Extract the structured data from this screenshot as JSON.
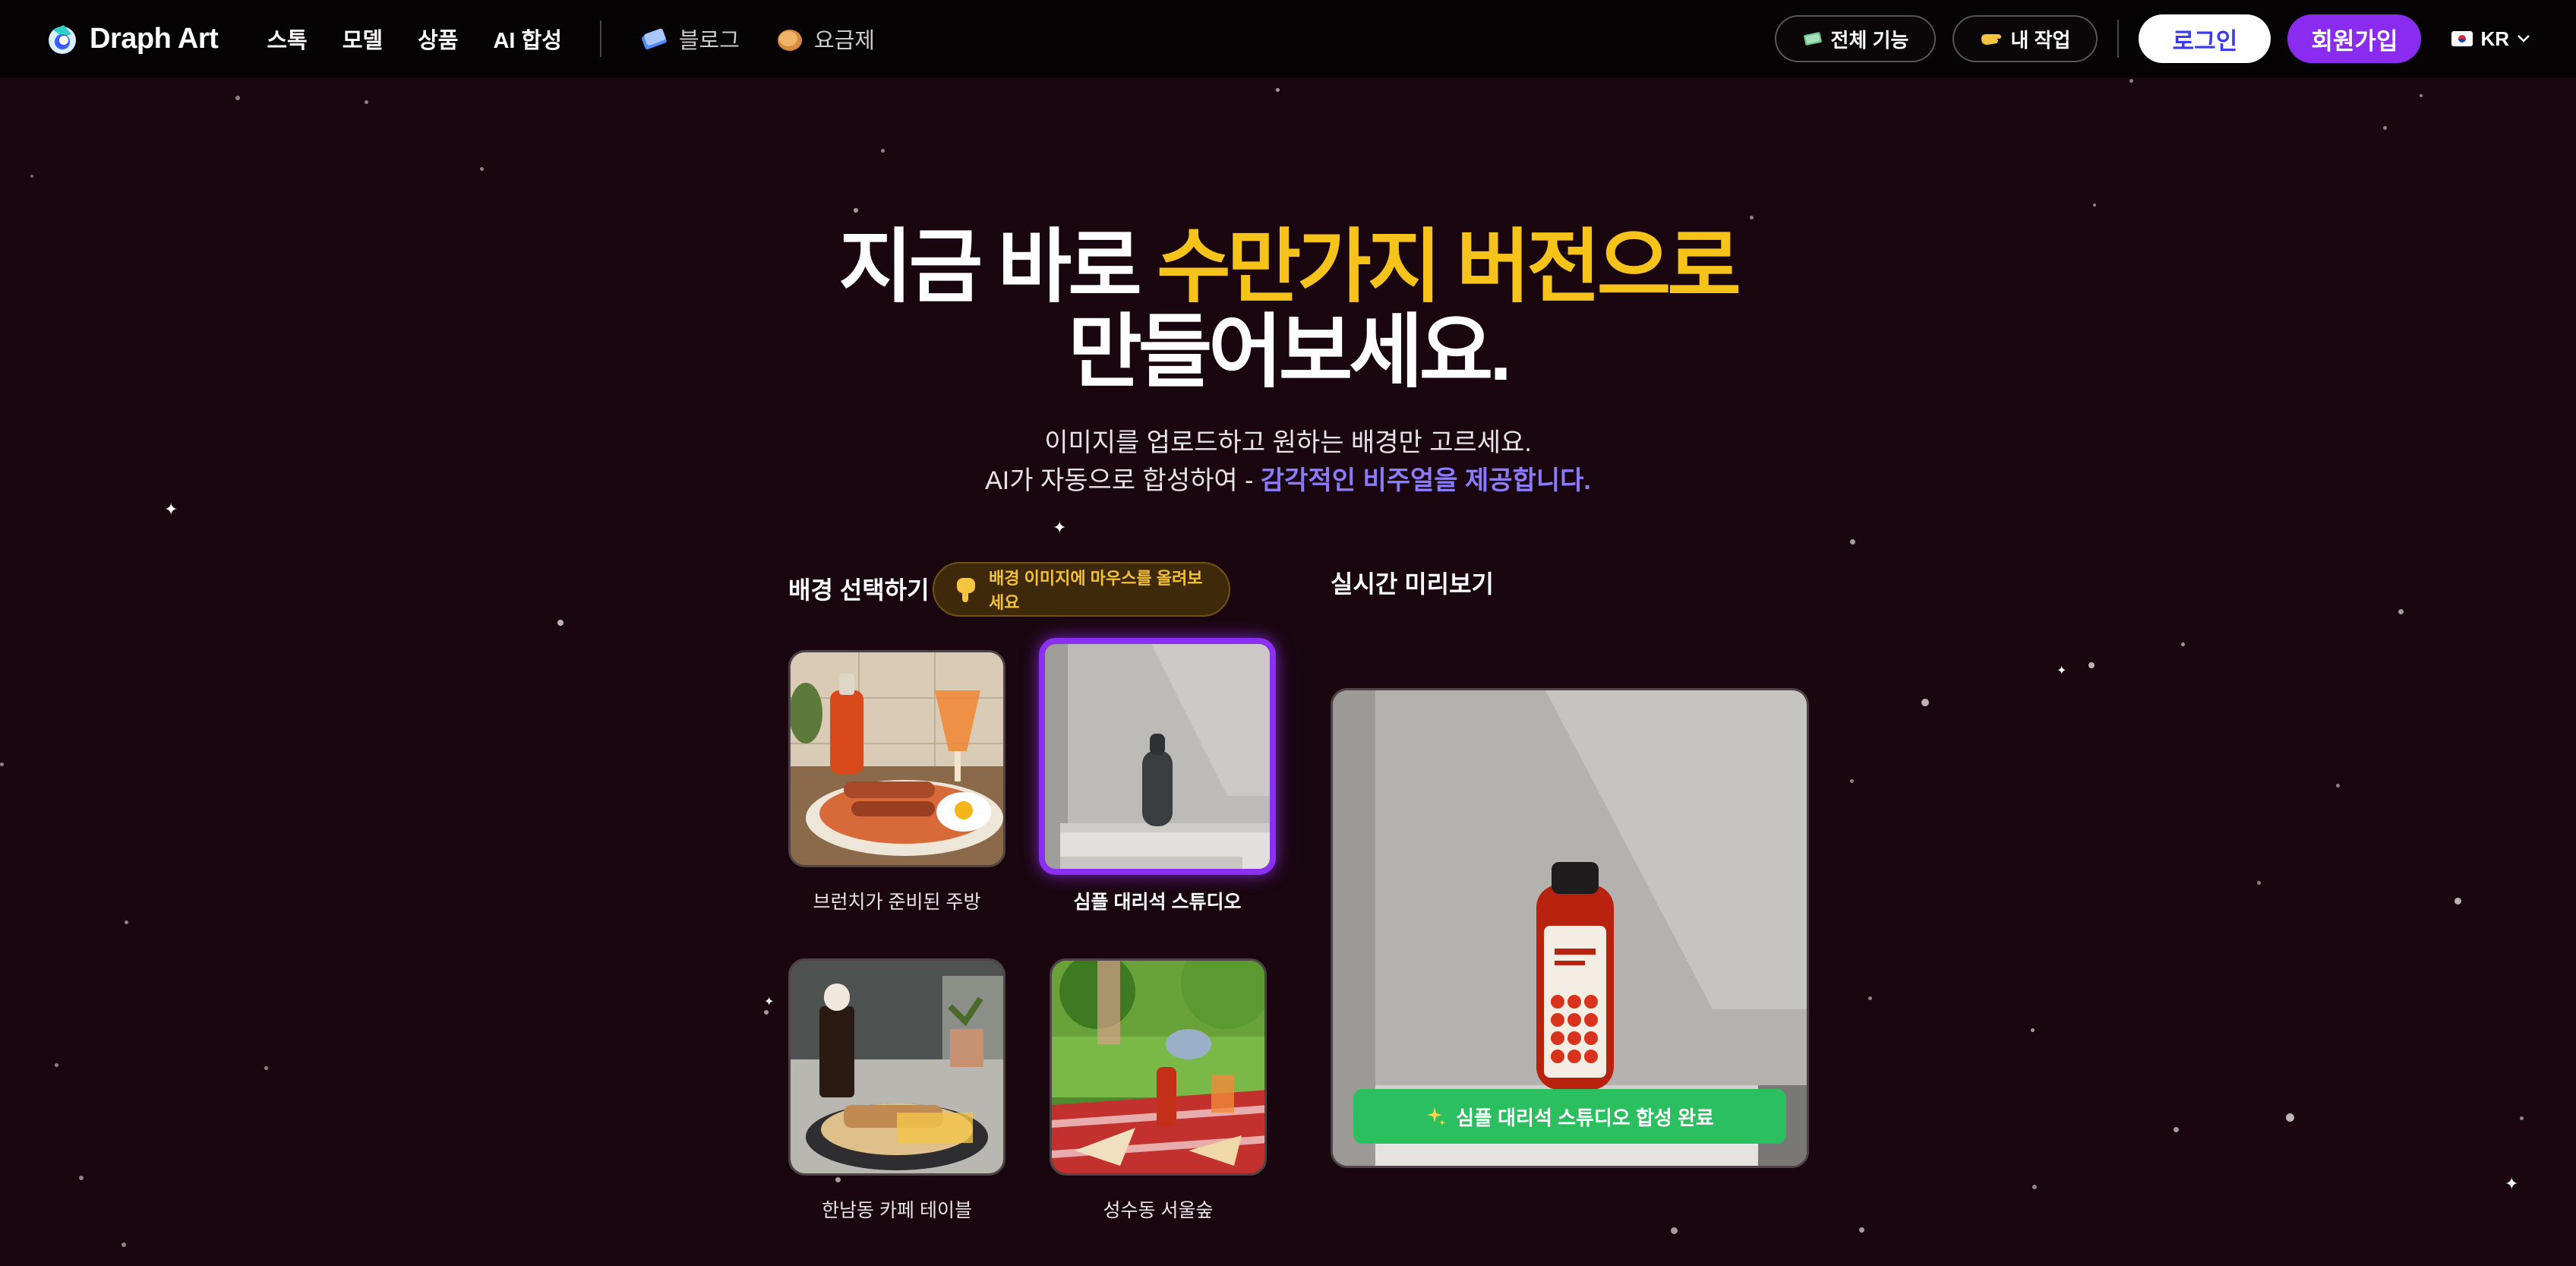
{
  "brand": {
    "name": "Draph Art",
    "colors": {
      "accent_yellow": "#f6c31a",
      "accent_purple": "#8a2cf0",
      "accent_violet": "#8b7bff",
      "success_green": "#2bbf5f"
    }
  },
  "nav": {
    "links": [
      "스톡",
      "모델",
      "상품",
      "AI 합성"
    ],
    "icon_links": [
      {
        "label": "블로그",
        "icon": "book-icon"
      },
      {
        "label": "요금제",
        "icon": "coin-icon"
      }
    ],
    "all_features": {
      "label": "전체 기능",
      "icon": "money-icon"
    },
    "my_work": {
      "label": "내 작업",
      "icon": "hand-icon"
    },
    "login": "로그인",
    "signup": "회원가입",
    "language": {
      "code": "KR",
      "icon": "korea-flag-icon"
    }
  },
  "hero": {
    "title_line1_plain": "지금 바로 ",
    "title_line1_highlight": "수만가지 버전으로",
    "title_line2": "만들어보세요.",
    "subtitle_line1": "이미지를 업로드하고 원하는 배경만 고르세요.",
    "subtitle_line2_plain": "AI가 자동으로 합성하여 - ",
    "subtitle_line2_accent": "감각적인 비주얼을 제공합니다."
  },
  "selector": {
    "label": "배경 선택하기",
    "hint": "배경 이미지에 마우스를 올려보세요",
    "hint_icon": "pointing-down-hand-icon",
    "backgrounds": [
      {
        "label": "브런치가 준비된 주방",
        "selected": false
      },
      {
        "label": "심플 대리석 스튜디오",
        "selected": true
      },
      {
        "label": "한남동 카페 테이블",
        "selected": false
      },
      {
        "label": "성수동 서울숲",
        "selected": false
      }
    ]
  },
  "preview": {
    "label": "실시간 미리보기",
    "status_icon": "sparkles-icon",
    "status": "심플 대리석 스튜디오 합성 완료"
  }
}
